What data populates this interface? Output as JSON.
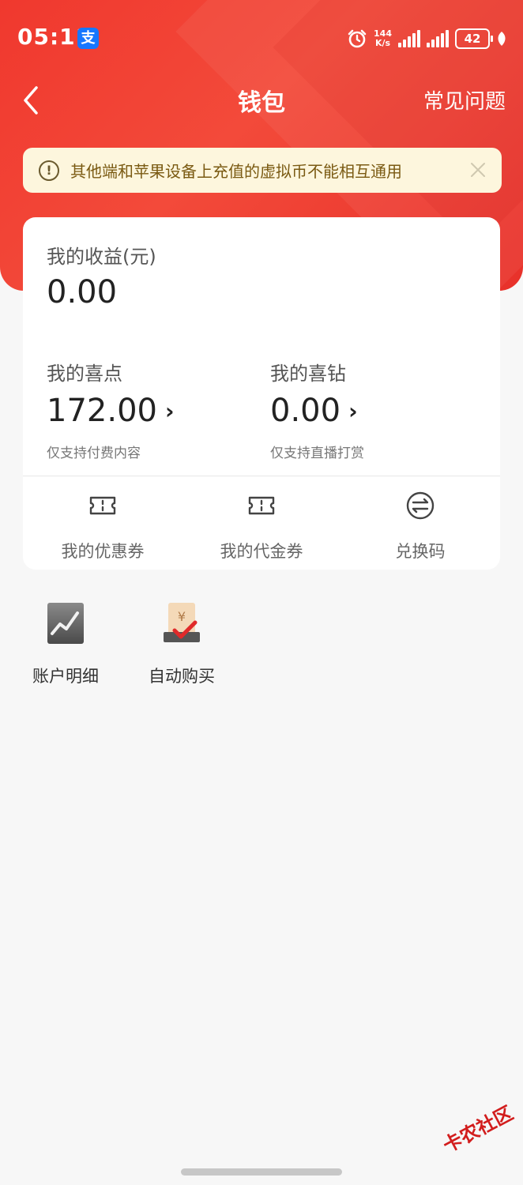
{
  "status_bar": {
    "time": "05:11",
    "alipay_badge": "支",
    "net_speed_value": "144",
    "net_speed_unit": "K/s",
    "battery": "42"
  },
  "nav": {
    "title": "钱包",
    "faq_label": "常见问题"
  },
  "notice": {
    "text": "其他端和苹果设备上充值的虚拟币不能相互通用"
  },
  "earnings": {
    "label": "我的收益(元)",
    "value": "0.00"
  },
  "points": {
    "label": "我的喜点",
    "value": "172.00",
    "note": "仅支持付费内容"
  },
  "diamonds": {
    "label": "我的喜钻",
    "value": "0.00",
    "note": "仅支持直播打赏"
  },
  "features": {
    "coupon": "我的优惠券",
    "voucher": "我的代金券",
    "redeem": "兑换码"
  },
  "tools": {
    "account_detail": "账户明细",
    "auto_buy": "自动购买"
  },
  "watermark": "卡农社区",
  "colors": {
    "brand_red": "#f0382e",
    "notice_bg": "#fdf6dd",
    "notice_text": "#7a5a12"
  }
}
